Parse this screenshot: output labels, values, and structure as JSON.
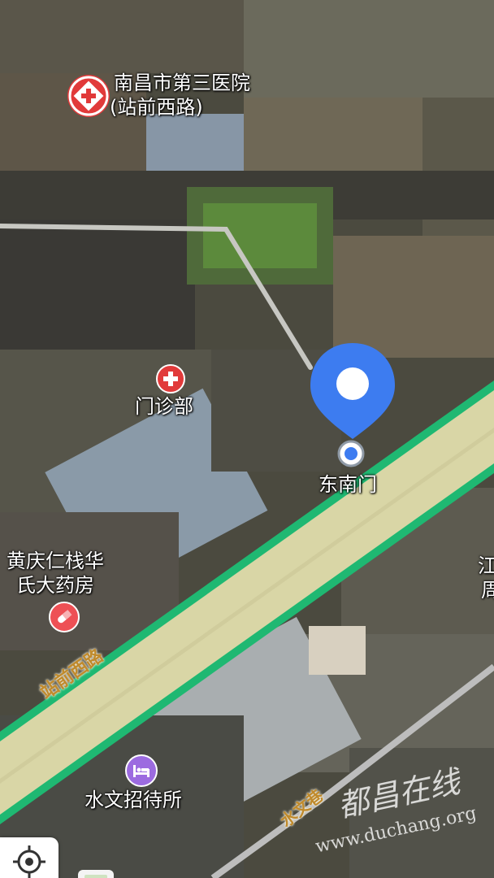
{
  "map": {
    "pois": [
      {
        "name": "hospital",
        "line1": "南昌市第三医院",
        "line2": "(站前西路)",
        "icon": "hospital-icon"
      },
      {
        "name": "clinic",
        "line1": "门诊部",
        "icon": "medical-cross-icon"
      },
      {
        "name": "pharmacy",
        "line1": "黄庆仁栈华",
        "line2": "氏大药房",
        "icon": "pill-icon"
      },
      {
        "name": "hotel",
        "line1": "水文招待所",
        "icon": "bed-icon"
      },
      {
        "name": "gate",
        "line1": "东南门",
        "icon": "gate-dot-icon"
      },
      {
        "name": "edge",
        "line1": "江",
        "line2": "周"
      }
    ],
    "roads": {
      "main": "站前西路",
      "alley": "水文巷"
    },
    "colors": {
      "road_fill": "#d9d6a6",
      "road_border": "#1fb872",
      "pin_blue": "#3d7cf0",
      "hospital_red": "#e13a3a",
      "pharmacy_red": "#ee5055",
      "hotel_purple": "#9c6be0"
    }
  },
  "watermark": {
    "title": "都昌在线",
    "url": "www.duchang.org"
  },
  "controls": {
    "locate_icon": "crosshair-icon",
    "layers_icon": "layers-icon"
  }
}
